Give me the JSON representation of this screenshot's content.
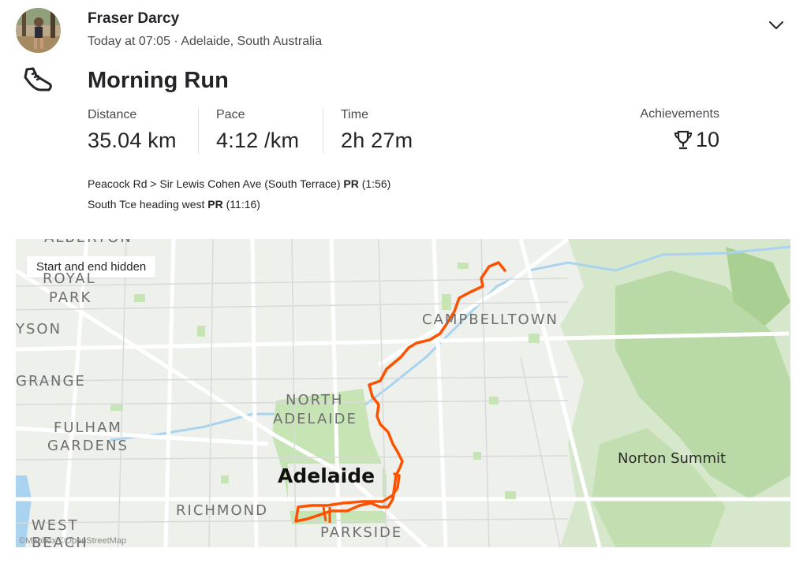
{
  "athlete": {
    "name": "Fraser Darcy",
    "timestamp": "Today at 07:05",
    "separator": "·",
    "location": "Adelaide, South Australia"
  },
  "activity": {
    "icon": "running-shoe-icon",
    "title": "Morning Run"
  },
  "stats": [
    {
      "label": "Distance",
      "value": "35.04 km"
    },
    {
      "label": "Pace",
      "value": "4:12 /km"
    },
    {
      "label": "Time",
      "value": "2h 27m"
    }
  ],
  "achievements": {
    "label": "Achievements",
    "icon": "trophy-icon",
    "count": "10"
  },
  "segments": [
    {
      "name": "Peacock Rd > Sir Lewis Cohen Ave (South Terrace)",
      "badge": "PR",
      "time": "(1:56)"
    },
    {
      "name": "South Tce heading west",
      "badge": "PR",
      "time": "(11:16)"
    }
  ],
  "map": {
    "badge": "Start and end hidden",
    "labels": {
      "alberton": "ALBERTON",
      "royal_park_1": "ROYAL",
      "royal_park_2": "PARK",
      "henley": "YSON",
      "grange": "GRANGE",
      "campbelltown": "CAMPBELLTOWN",
      "north_adelaide_1": "NORTH",
      "north_adelaide_2": "ADELAIDE",
      "fulham_1": "FULHAM",
      "fulham_2": "GARDENS",
      "adelaide": "Adelaide",
      "norton_summit": "Norton Summit",
      "richmond": "RICHMOND",
      "west_beach_1": "WEST",
      "west_beach_2": "BEACH",
      "parkside": "PARKSIDE"
    },
    "attribution": "©Mapbox ©OpenStreetMap",
    "route_color": "#fc5200",
    "water_color": "#a9d3ee",
    "park_color": "#c7e5b4"
  }
}
